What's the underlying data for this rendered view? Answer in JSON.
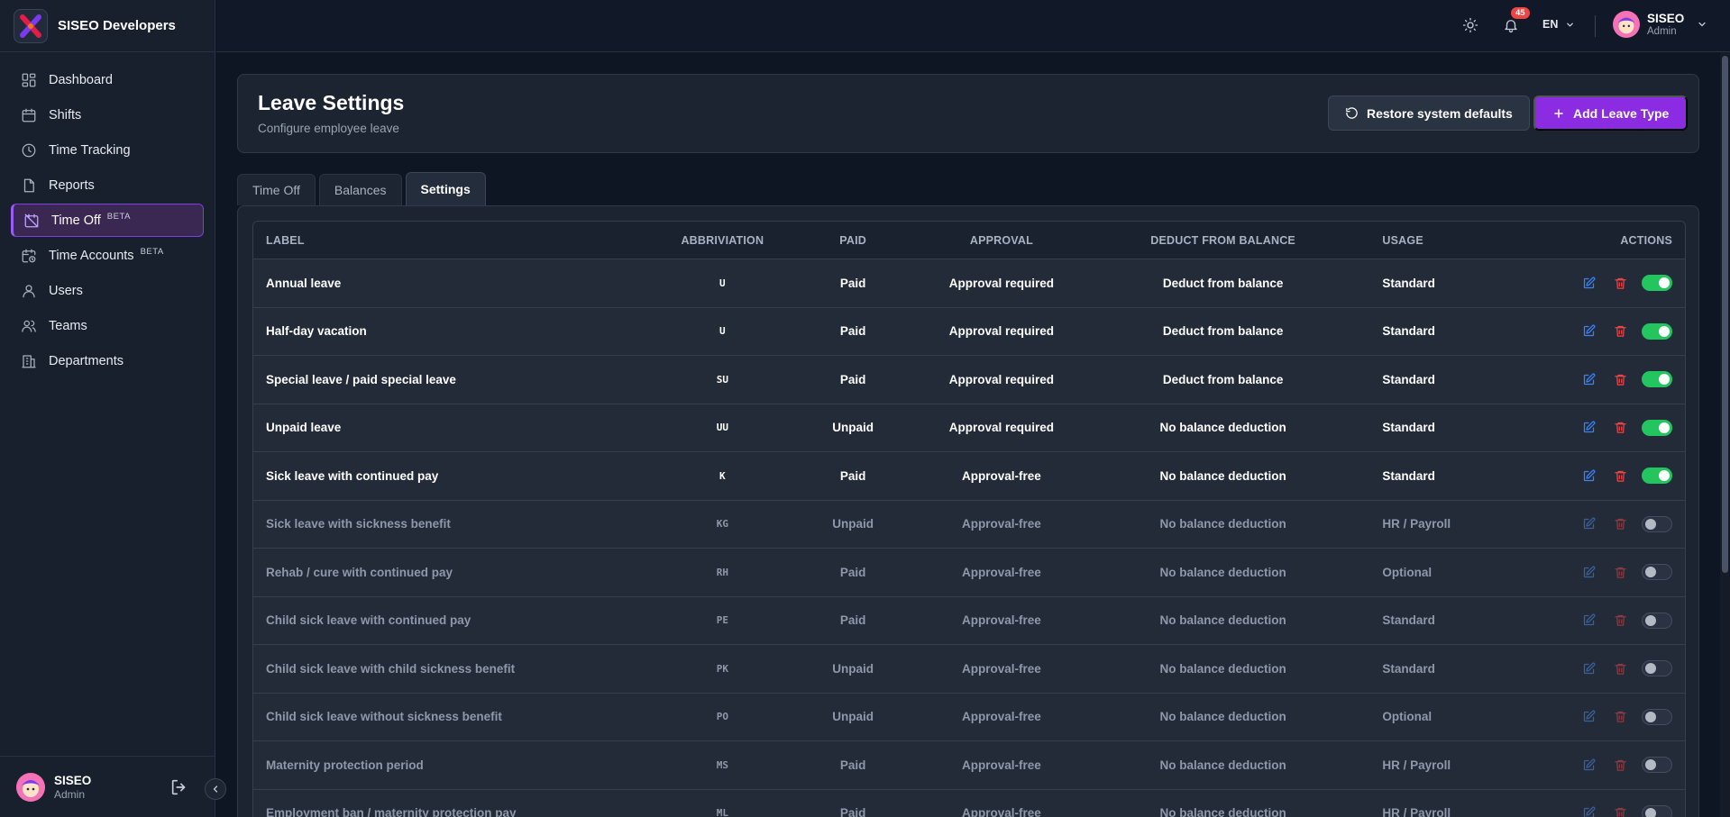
{
  "brand": {
    "name": "SISEO Developers"
  },
  "nav": [
    {
      "label": "Dashboard",
      "icon": "dashboard-icon",
      "beta": ""
    },
    {
      "label": "Shifts",
      "icon": "calendar-icon",
      "beta": ""
    },
    {
      "label": "Time Tracking",
      "icon": "clock-icon",
      "beta": ""
    },
    {
      "label": "Reports",
      "icon": "file-icon",
      "beta": ""
    },
    {
      "label": "Time Off",
      "icon": "calendar-off-icon",
      "beta": "BETA",
      "active": true
    },
    {
      "label": "Time Accounts",
      "icon": "calendar-clock-icon",
      "beta": "BETA"
    },
    {
      "label": "Users",
      "icon": "user-icon",
      "beta": ""
    },
    {
      "label": "Teams",
      "icon": "users-icon",
      "beta": ""
    },
    {
      "label": "Departments",
      "icon": "building-icon",
      "beta": ""
    }
  ],
  "user": {
    "name": "SISEO",
    "role": "Admin"
  },
  "topbar": {
    "notification_count": "45",
    "language": "EN"
  },
  "header": {
    "title": "Leave Settings",
    "subtitle": "Configure employee leave",
    "restore_label": "Restore system defaults",
    "add_label": "Add Leave Type"
  },
  "tabs": [
    {
      "label": "Time Off",
      "active": false
    },
    {
      "label": "Balances",
      "active": false
    },
    {
      "label": "Settings",
      "active": true
    }
  ],
  "table": {
    "columns": {
      "label": "LABEL",
      "abbr": "ABBRIVIATION",
      "paid": "PAID",
      "approval": "APPROVAL",
      "deduct": "DEDUCT FROM BALANCE",
      "usage": "USAGE",
      "actions": "ACTIONS"
    },
    "rows": [
      {
        "label": "Annual leave",
        "abbr": "U",
        "paid": "Paid",
        "approval": "Approval required",
        "deduct": "Deduct from balance",
        "usage": "Standard",
        "enabled": true
      },
      {
        "label": "Half-day vacation",
        "abbr": "U",
        "paid": "Paid",
        "approval": "Approval required",
        "deduct": "Deduct from balance",
        "usage": "Standard",
        "enabled": true
      },
      {
        "label": "Special leave / paid special leave",
        "abbr": "SU",
        "paid": "Paid",
        "approval": "Approval required",
        "deduct": "Deduct from balance",
        "usage": "Standard",
        "enabled": true
      },
      {
        "label": "Unpaid leave",
        "abbr": "UU",
        "paid": "Unpaid",
        "approval": "Approval required",
        "deduct": "No balance deduction",
        "usage": "Standard",
        "enabled": true
      },
      {
        "label": "Sick leave with continued pay",
        "abbr": "K",
        "paid": "Paid",
        "approval": "Approval-free",
        "deduct": "No balance deduction",
        "usage": "Standard",
        "enabled": true
      },
      {
        "label": "Sick leave with sickness benefit",
        "abbr": "KG",
        "paid": "Unpaid",
        "approval": "Approval-free",
        "deduct": "No balance deduction",
        "usage": "HR / Payroll",
        "enabled": false
      },
      {
        "label": "Rehab / cure with continued pay",
        "abbr": "RH",
        "paid": "Paid",
        "approval": "Approval-free",
        "deduct": "No balance deduction",
        "usage": "Optional",
        "enabled": false
      },
      {
        "label": "Child sick leave with continued pay",
        "abbr": "PE",
        "paid": "Paid",
        "approval": "Approval-free",
        "deduct": "No balance deduction",
        "usage": "Standard",
        "enabled": false
      },
      {
        "label": "Child sick leave with child sickness benefit",
        "abbr": "PK",
        "paid": "Unpaid",
        "approval": "Approval-free",
        "deduct": "No balance deduction",
        "usage": "Standard",
        "enabled": false
      },
      {
        "label": "Child sick leave without sickness benefit",
        "abbr": "PO",
        "paid": "Unpaid",
        "approval": "Approval-free",
        "deduct": "No balance deduction",
        "usage": "Optional",
        "enabled": false
      },
      {
        "label": "Maternity protection period",
        "abbr": "MS",
        "paid": "Paid",
        "approval": "Approval-free",
        "deduct": "No balance deduction",
        "usage": "HR / Payroll",
        "enabled": false
      },
      {
        "label": "Employment ban / maternity protection pay",
        "abbr": "ML",
        "paid": "Paid",
        "approval": "Approval-free",
        "deduct": "No balance deduction",
        "usage": "HR / Payroll",
        "enabled": false
      }
    ]
  },
  "colors": {
    "accent": "#8b2be2",
    "toggle_on": "#22c55e",
    "edit": "#3b82f6",
    "delete": "#ef4444",
    "badge": "#ef4444"
  }
}
